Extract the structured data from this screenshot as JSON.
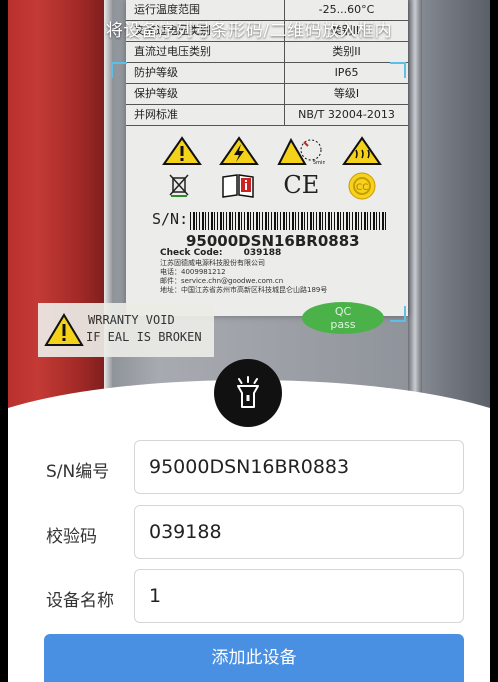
{
  "scanner": {
    "hint": "将设备序列号条形码/二维码放入框内",
    "label": {
      "rows": [
        {
          "k": "运行温度范围",
          "v": "-25...60°C"
        },
        {
          "k": "交流过电压类别",
          "v": "类别III"
        },
        {
          "k": "直流过电压类别",
          "v": "类别II"
        },
        {
          "k": "防护等级",
          "v": "IP65"
        },
        {
          "k": "保护等级",
          "v": "等级I"
        },
        {
          "k": "并网标准",
          "v": "NB/T 32004-2013"
        }
      ],
      "ce_mark": "CE",
      "time_mark": "5min",
      "sn_prefix": "S/N:",
      "sn": "95000DSN16BR0883",
      "check_code_label": "Check Code:",
      "check_code": "039188",
      "company_lines": [
        "江苏固德威电源科技股份有限公司",
        "电话：4009981212",
        "邮件：service.chn@goodwe.com.cn",
        "地址：中国江苏省苏州市高新区科技城昆仑山路189号"
      ]
    },
    "warranty": {
      "line1": "WRRANTY  VOID",
      "line2": "IF EAL IS BROKEN"
    },
    "qc": {
      "line1": "QC",
      "line2": "pass"
    }
  },
  "form": {
    "sn_label": "S/N编号",
    "sn_value": "95000DSN16BR0883",
    "check_label": "校验码",
    "check_value": "039188",
    "name_label": "设备名称",
    "name_value": "1",
    "add_button": "添加此设备"
  },
  "colors": {
    "primary": "#4a90e2",
    "frame_corner": "#5bc0e8",
    "torch_bg": "#111111"
  }
}
